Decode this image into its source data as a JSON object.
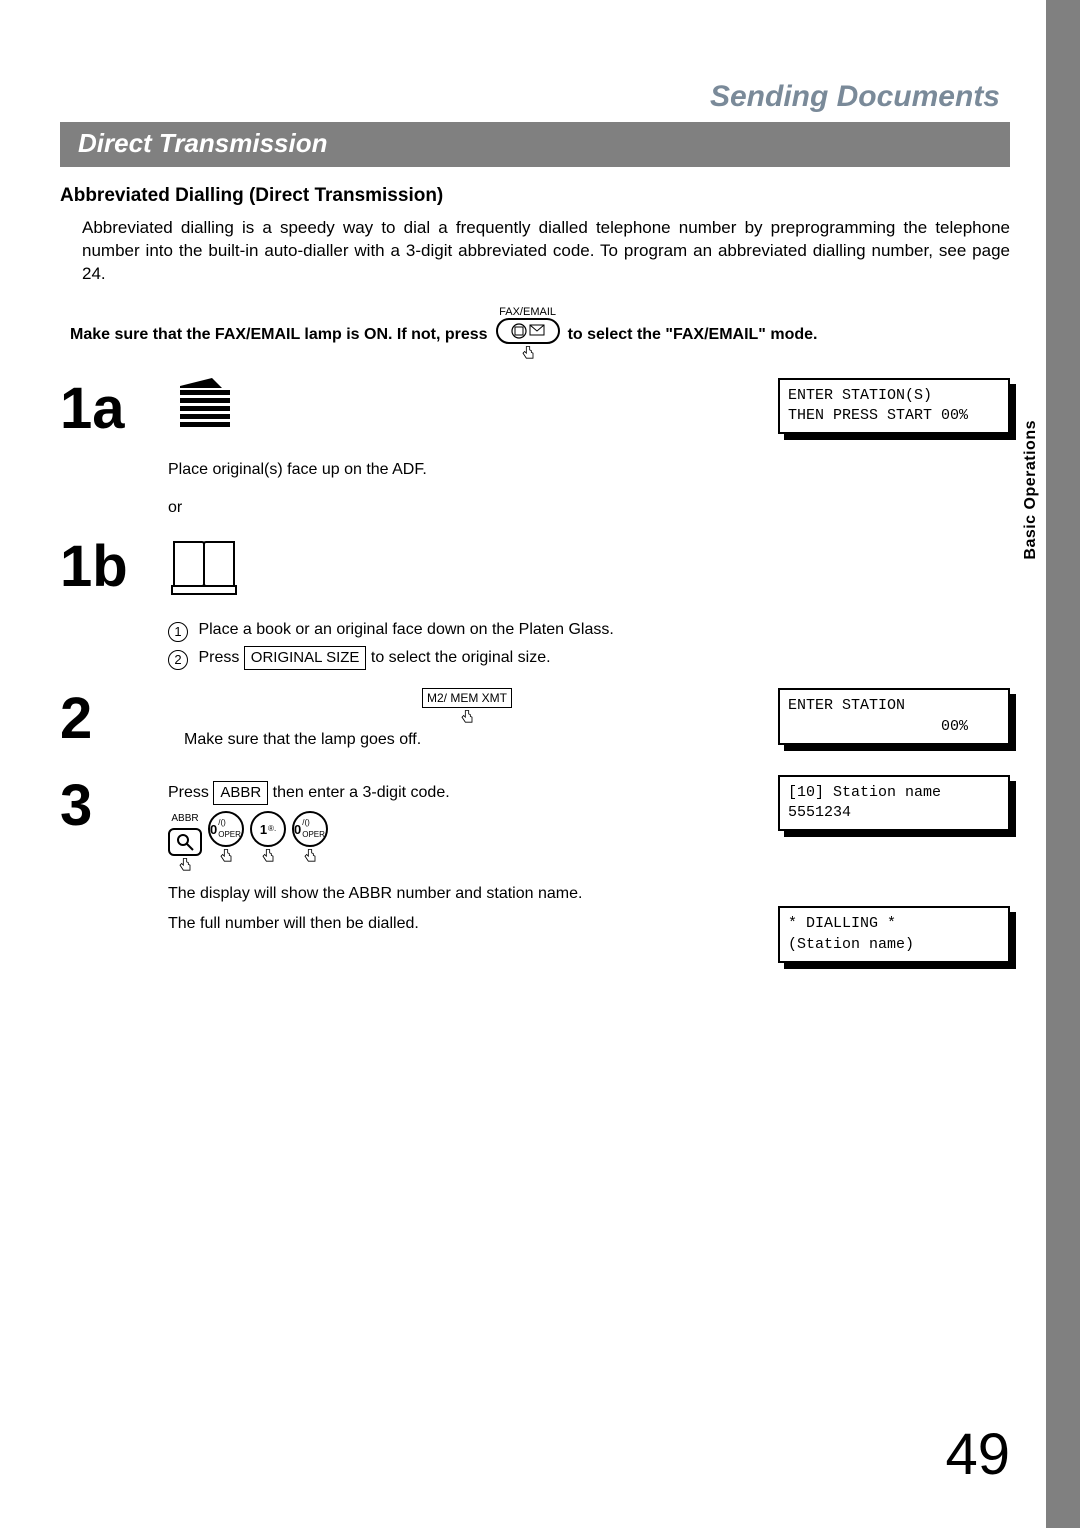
{
  "chapter": "Sending Documents",
  "section_title": "Direct Transmission",
  "subheading": "Abbreviated Dialling (Direct Transmission)",
  "intro": "Abbreviated dialling is a speedy way to dial a frequently dialled telephone number by preprogramming the telephone number into the built-in auto-dialler with a 3-digit abbreviated code. To program an abbreviated dialling number, see page 24.",
  "mode_line_a": "Make sure that the FAX/EMAIL lamp is ON.  If not, press",
  "mode_line_b": "to select the \"FAX/EMAIL\" mode.",
  "fax_email_label": "FAX/EMAIL",
  "side_tab": "Basic Operations",
  "page_number": "49",
  "steps": {
    "s1a": {
      "num": "1a",
      "caption": "Place original(s) face up on the ADF.",
      "lcd": "ENTER STATION(S)\nTHEN PRESS START 00%"
    },
    "or_word": "or",
    "s1b": {
      "num": "1b",
      "sub1": "Place a book or an original face down on the Platen Glass.",
      "sub2a": "Press ",
      "sub2_btn": "ORIGINAL   SIZE",
      "sub2b": " to select the original size."
    },
    "s2": {
      "num": "2",
      "btn_label": "M2/    MEM XMT",
      "text": "Make sure that the lamp goes off.",
      "lcd": "ENTER STATION\n                 00%"
    },
    "s3": {
      "num": "3",
      "text1a": "Press ",
      "btn_label_abbr": "ABBR",
      "text1b": " then enter a 3-digit code.",
      "key_abbr_lbl": "ABBR",
      "key0": "0",
      "key0_sup": "/()\nOPER",
      "key1": "1",
      "key1_sup": "®.",
      "lcd1": "[10] Station name\n5551234",
      "para2": "The display will show the ABBR number and station name.",
      "para3": "The full number will then be dialled.",
      "lcd2": "* DIALLING *\n(Station name)"
    }
  }
}
